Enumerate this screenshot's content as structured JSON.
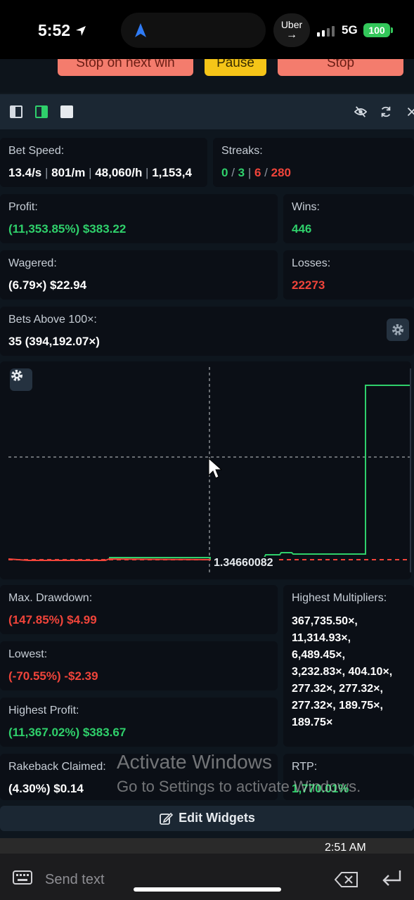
{
  "status_bar": {
    "time": "5:52",
    "island_app": "Uber",
    "network": "5G",
    "battery": "100"
  },
  "controls": {
    "stop_on_next_win": "Stop on next win",
    "pause": "Pause",
    "stop": "Stop"
  },
  "stats": {
    "bet_speed": {
      "label": "Bet Speed:",
      "per_sec": "13.4/s",
      "per_min": "801/m",
      "per_hour": "48,060/h",
      "per_day": "1,153,4"
    },
    "streaks": {
      "label": "Streaks:",
      "win_current": "0",
      "win_max": "3",
      "loss_current": "6",
      "loss_max": "280"
    },
    "profit": {
      "label": "Profit:",
      "value": "(11,353.85%) $383.22"
    },
    "wins": {
      "label": "Wins:",
      "value": "446"
    },
    "wagered": {
      "label": "Wagered:",
      "value": "(6.79×) $22.94"
    },
    "losses": {
      "label": "Losses:",
      "value": "22273"
    },
    "bets_above": {
      "label": "Bets Above 100×:",
      "value": "35 (394,192.07×)"
    },
    "max_drawdown": {
      "label": "Max. Drawdown:",
      "value": "(147.85%) $4.99"
    },
    "highest_multipliers": {
      "label": "Highest Multipliers:",
      "values": [
        "367,735.50×,",
        "11,314.93×,",
        "6,489.45×,",
        "3,232.83×, 404.10×,",
        "277.32×, 277.32×,",
        "277.32×, 189.75×,",
        "189.75×"
      ]
    },
    "lowest": {
      "label": "Lowest:",
      "value": "(-70.55%) -$2.39"
    },
    "highest_profit": {
      "label": "Highest Profit:",
      "value": "(11,367.02%) $383.67"
    },
    "rakeback": {
      "label": "Rakeback Claimed:",
      "value": "(4.30%) $0.14"
    },
    "rtp": {
      "label": "RTP:",
      "value": "1,770.01%"
    }
  },
  "chart": {
    "crosshair_value": "1.34660082"
  },
  "edit_widgets": "Edit Widgets",
  "watermark": {
    "line1": "Activate Windows",
    "line2": "Go to Settings to activate Windows."
  },
  "taskbar_time": "2:51 AM",
  "message_input": {
    "placeholder": "Send text"
  },
  "colors": {
    "profit_green": "#2fd06b",
    "loss_red": "#f0443a",
    "stop_button": "#f47c6d",
    "pause_button": "#f5c518"
  }
}
